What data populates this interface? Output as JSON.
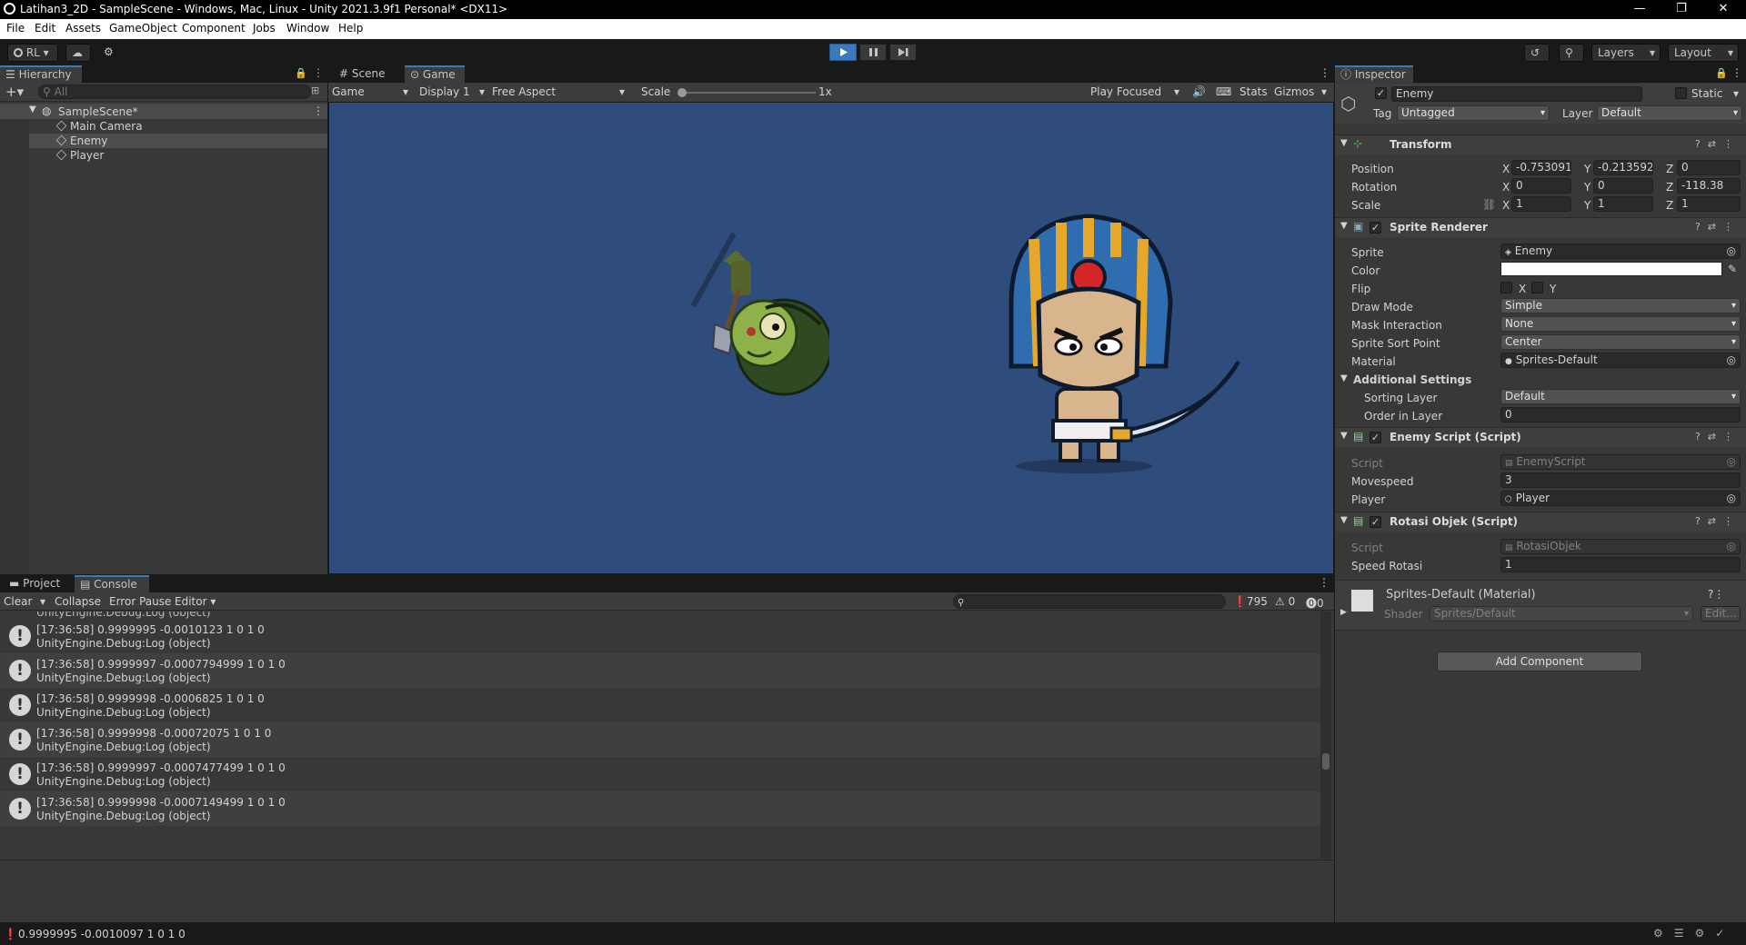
{
  "window": {
    "title": "Latihan3_2D - SampleScene - Windows, Mac, Linux - Unity 2021.3.9f1 Personal* <DX11>",
    "controls": {
      "minimize": "—",
      "restore": "❐",
      "close": "✕"
    }
  },
  "menu": [
    "File",
    "Edit",
    "Assets",
    "GameObject",
    "Component",
    "Jobs",
    "Window",
    "Help"
  ],
  "toolbar": {
    "account": "RL",
    "layers": "Layers",
    "layout": "Layout"
  },
  "hierarchy": {
    "tab": "Hierarchy",
    "search_placeholder": "All",
    "scene": "SampleScene*",
    "items": [
      "Main Camera",
      "Enemy",
      "Player"
    ],
    "selected": "Enemy"
  },
  "game_view": {
    "tabs": [
      "Scene",
      "Game"
    ],
    "active_tab": "Game",
    "mode": "Game",
    "display": "Display 1",
    "aspect": "Free Aspect",
    "scale_label": "Scale",
    "scale_value": "1x",
    "play_focused": "Play Focused",
    "stats": "Stats",
    "gizmos": "Gizmos",
    "background": "#2e4d7c"
  },
  "console": {
    "tabs": [
      "Project",
      "Console"
    ],
    "active_tab": "Console",
    "buttons": {
      "clear": "Clear",
      "collapse": "Collapse",
      "error_pause": "Error Pause",
      "editor": "Editor"
    },
    "counts": {
      "logs": "795",
      "warnings": "0",
      "errors": "0"
    },
    "entries": [
      {
        "line1": "[17:36:58] 0.9999995 -0.0010123 1 0 1 0",
        "line2": "UnityEngine.Debug:Log (object)"
      },
      {
        "line1": "[17:36:58] 0.9999997 -0.0007794999 1 0 1 0",
        "line2": "UnityEngine.Debug:Log (object)"
      },
      {
        "line1": "[17:36:58] 0.9999998 -0.0006825 1 0 1 0",
        "line2": "UnityEngine.Debug:Log (object)"
      },
      {
        "line1": "[17:36:58] 0.9999998 -0.00072075 1 0 1 0",
        "line2": "UnityEngine.Debug:Log (object)"
      },
      {
        "line1": "[17:36:58] 0.9999997 -0.0007477499 1 0 1 0",
        "line2": "UnityEngine.Debug:Log (object)"
      },
      {
        "line1": "[17:36:58] 0.9999998 -0.0007149499 1 0 1 0",
        "line2": "UnityEngine.Debug:Log (object)"
      }
    ],
    "partial_top": "UnityEngine.Debug:Log (object)"
  },
  "status_bar": {
    "message": "0.9999995 -0.0010097 1 0 1 0"
  },
  "inspector": {
    "tab": "Inspector",
    "object_name": "Enemy",
    "static_label": "Static",
    "tag_label": "Tag",
    "tag_value": "Untagged",
    "layer_label": "Layer",
    "layer_value": "Default",
    "transform": {
      "title": "Transform",
      "position": {
        "label": "Position",
        "x": "-0.7530919",
        "y": "-0.2135922",
        "z": "0"
      },
      "rotation": {
        "label": "Rotation",
        "x": "0",
        "y": "0",
        "z": "-118.38"
      },
      "scale": {
        "label": "Scale",
        "x": "1",
        "y": "1",
        "z": "1"
      }
    },
    "sprite_renderer": {
      "title": "Sprite Renderer",
      "sprite_label": "Sprite",
      "sprite_value": "Enemy",
      "color_label": "Color",
      "flip_label": "Flip",
      "flip_x": "X",
      "flip_y": "Y",
      "draw_mode_label": "Draw Mode",
      "draw_mode_value": "Simple",
      "mask_label": "Mask Interaction",
      "mask_value": "None",
      "sort_point_label": "Sprite Sort Point",
      "sort_point_value": "Center",
      "material_label": "Material",
      "material_value": "Sprites-Default",
      "additional": "Additional Settings",
      "sorting_layer_label": "Sorting Layer",
      "sorting_layer_value": "Default",
      "order_label": "Order in Layer",
      "order_value": "0"
    },
    "enemy_script": {
      "title": "Enemy Script (Script)",
      "script_label": "Script",
      "script_value": "EnemyScript",
      "movespeed_label": "Movespeed",
      "movespeed_value": "3",
      "player_label": "Player",
      "player_value": "Player"
    },
    "rotasi_script": {
      "title": "Rotasi Objek (Script)",
      "script_label": "Script",
      "script_value": "RotasiObjek",
      "speed_label": "Speed Rotasi",
      "speed_value": "1"
    },
    "material": {
      "title": "Sprites-Default (Material)",
      "shader_label": "Shader",
      "shader_value": "Sprites/Default",
      "edit": "Edit..."
    },
    "add_component": "Add Component"
  }
}
